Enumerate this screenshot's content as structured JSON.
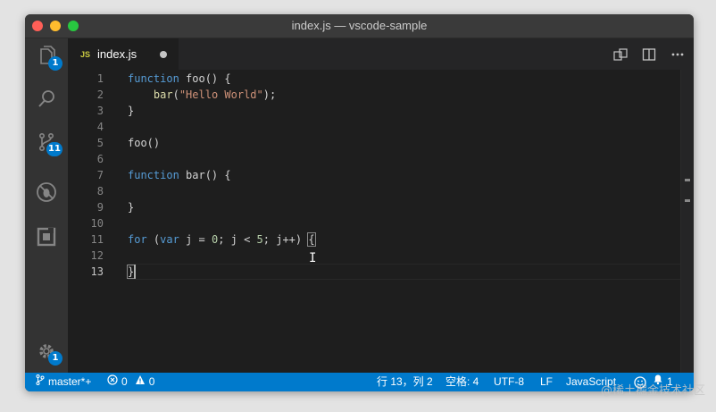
{
  "window": {
    "title": "index.js — vscode-sample"
  },
  "activity_bar": {
    "items": [
      {
        "name": "explorer",
        "icon": "files-icon",
        "badge": "1"
      },
      {
        "name": "search",
        "icon": "search-icon",
        "badge": ""
      },
      {
        "name": "source-control",
        "icon": "source-control-icon",
        "badge": "11"
      },
      {
        "name": "debug",
        "icon": "debug-icon",
        "badge": ""
      },
      {
        "name": "extensions",
        "icon": "extensions-icon",
        "badge": ""
      }
    ],
    "manage": {
      "icon": "gear-icon",
      "badge": "1"
    }
  },
  "editor": {
    "tab": {
      "icon_text": "JS",
      "label": "index.js",
      "dirty": true
    },
    "actions": [
      "open-changes-icon",
      "split-editor-icon",
      "more-actions-icon"
    ],
    "line_numbers": [
      "1",
      "2",
      "3",
      "4",
      "5",
      "6",
      "7",
      "8",
      "9",
      "10",
      "11",
      "12",
      "13"
    ],
    "active_line": "13",
    "lines": {
      "l1": {
        "kw": "function",
        "rest": " foo() {"
      },
      "l2": {
        "indent": "    ",
        "fn": "bar",
        "open": "(",
        "str": "\"Hello World\"",
        "close": ");"
      },
      "l3": {
        "text": "}"
      },
      "l5": {
        "text": "foo()"
      },
      "l7": {
        "kw": "function",
        "rest": " bar() {"
      },
      "l9": {
        "text": "}"
      },
      "l11": {
        "kw": "for",
        "p1": " (",
        "kw2": "var",
        "p2": " j = ",
        "n1": "0",
        "p3": "; j < ",
        "n2": "5",
        "p4": "; j++) ",
        "brace": "{"
      },
      "l13": {
        "text": "}"
      }
    }
  },
  "status_bar": {
    "branch": "master*+",
    "errors": "0",
    "warnings": "0",
    "position": "行 13，列 2",
    "indent": "空格: 4",
    "encoding": "UTF-8",
    "eol": "LF",
    "language": "JavaScript",
    "notifications": "1"
  },
  "watermark": "@稀土掘金技术社区",
  "colors": {
    "accent": "#007acc",
    "keyword": "#569cd6",
    "string": "#ce9178",
    "number": "#b5cea8",
    "function": "#dcdcaa"
  }
}
